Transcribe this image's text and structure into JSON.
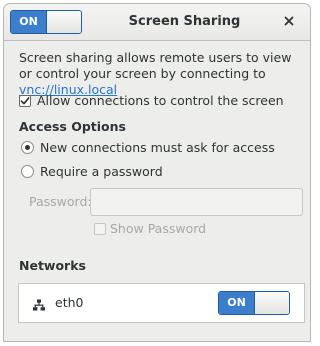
{
  "window": {
    "title": "Screen Sharing",
    "toggle_label": "ON"
  },
  "description": {
    "text": "Screen sharing allows remote users to view or control your screen by connecting to ",
    "link": "vnc://linux.local"
  },
  "allow_control": {
    "label": "Allow connections to control the screen",
    "checked": true
  },
  "access_options": {
    "heading": "Access Options",
    "options": [
      {
        "label": "New connections must ask for access",
        "selected": true
      },
      {
        "label": "Require a password",
        "selected": false
      }
    ],
    "password_label": "Password:",
    "password_value": "",
    "show_password_label": "Show Password"
  },
  "networks": {
    "heading": "Networks",
    "items": [
      {
        "name": "eth0",
        "toggle_label": "ON"
      }
    ]
  },
  "colors": {
    "accent": "#3b7fcc",
    "link": "#2a76c6",
    "background": "#ededeb"
  },
  "icons": {
    "close": "close-icon",
    "network": "network-wired-icon",
    "check": "checkmark-icon"
  }
}
